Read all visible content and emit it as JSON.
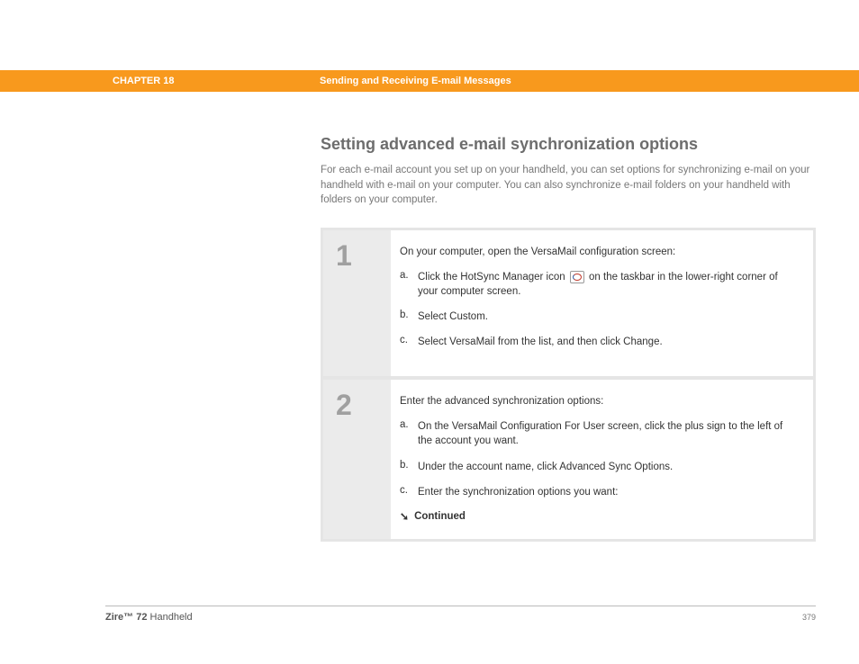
{
  "header": {
    "chapter": "CHAPTER 18",
    "title": "Sending and Receiving E-mail Messages"
  },
  "main": {
    "heading": "Setting advanced e-mail synchronization options",
    "intro": "For each e-mail account you set up on your handheld, you can set options for synchronizing e-mail on your handheld with e-mail on your computer. You can also synchronize e-mail folders on your handheld with folders on your computer."
  },
  "steps": [
    {
      "num": "1",
      "intro": "On your computer, open the VersaMail configuration screen:",
      "items": [
        {
          "letter": "a.",
          "pre": "Click the HotSync Manager icon ",
          "post": " on the taskbar in the lower-right corner of your computer screen.",
          "icon": true
        },
        {
          "letter": "b.",
          "text": "Select Custom."
        },
        {
          "letter": "c.",
          "text": "Select VersaMail from the list, and then click Change."
        }
      ]
    },
    {
      "num": "2",
      "intro": "Enter the advanced synchronization options:",
      "items": [
        {
          "letter": "a.",
          "text": "On the VersaMail Configuration For User screen, click the plus sign to the left of the account you want."
        },
        {
          "letter": "b.",
          "text": "Under the account name, click Advanced Sync Options."
        },
        {
          "letter": "c.",
          "text": "Enter the synchronization options you want:"
        }
      ],
      "continued": "Continued"
    }
  ],
  "footer": {
    "product_bold": "Zire™ 72",
    "product_rest": " Handheld",
    "page": "379"
  }
}
